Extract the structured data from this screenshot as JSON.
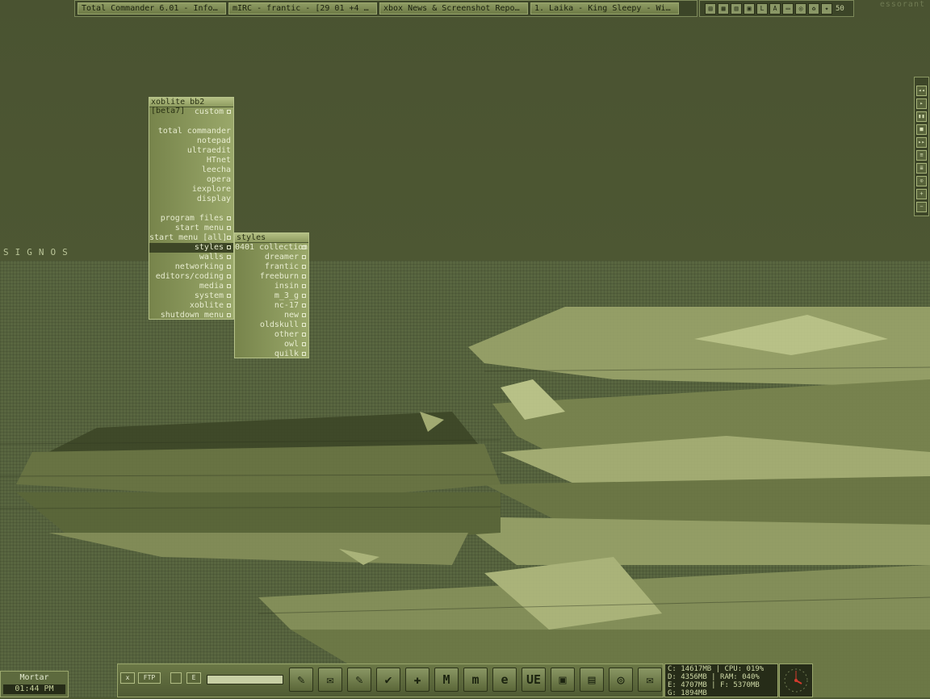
{
  "desktop": {
    "brand_left": "SIGNOS",
    "brand_right": "essorant"
  },
  "taskbar": {
    "tasks": [
      {
        "label": "Total Commander 6.01 - Inform..."
      },
      {
        "label": "mIRC - frantic - [29 01 +4 T24..."
      },
      {
        "label": "xbox News & Screenshot Reposi..."
      },
      {
        "label": "1. Laika - King Sleepy - Winamp"
      }
    ],
    "tray_number": "50"
  },
  "menu": {
    "title": "xoblite bb2 [beta7]",
    "items": [
      {
        "label": "custom",
        "type": "submenu"
      },
      {
        "label": "",
        "type": "separator"
      },
      {
        "label": "total commander",
        "type": "left"
      },
      {
        "label": "notepad",
        "type": "item"
      },
      {
        "label": "ultraedit",
        "type": "item"
      },
      {
        "label": "HTnet",
        "type": "item"
      },
      {
        "label": "leecha",
        "type": "item"
      },
      {
        "label": "opera",
        "type": "item"
      },
      {
        "label": "iexplore",
        "type": "item"
      },
      {
        "label": "display",
        "type": "item"
      },
      {
        "label": "",
        "type": "separator"
      },
      {
        "label": "program files",
        "type": "submenu"
      },
      {
        "label": "start menu",
        "type": "submenu"
      },
      {
        "label": "start menu [all]",
        "type": "submenu"
      },
      {
        "label": "styles",
        "type": "submenu-selected"
      },
      {
        "label": "walls",
        "type": "submenu"
      },
      {
        "label": "networking",
        "type": "submenu"
      },
      {
        "label": "editors/coding",
        "type": "submenu"
      },
      {
        "label": "media",
        "type": "submenu"
      },
      {
        "label": "system",
        "type": "submenu"
      },
      {
        "label": "xoblite",
        "type": "submenu"
      },
      {
        "label": "shutdown menu",
        "type": "submenu"
      }
    ]
  },
  "styles_menu": {
    "title": "styles",
    "items": [
      {
        "label": "0401 collection"
      },
      {
        "label": "dreamer"
      },
      {
        "label": "frantic"
      },
      {
        "label": "freeburn"
      },
      {
        "label": "insin"
      },
      {
        "label": "m_3_g"
      },
      {
        "label": "nc-17"
      },
      {
        "label": "new"
      },
      {
        "label": "oldskull"
      },
      {
        "label": "other"
      },
      {
        "label": "owl"
      },
      {
        "label": "quilk"
      }
    ]
  },
  "player": {
    "buttons": [
      "◂◂",
      "▸",
      "▮▮",
      "■",
      "▸▸",
      "≡",
      "≣",
      "⊙",
      "+",
      "−"
    ]
  },
  "clock": {
    "label": "Mortar",
    "time": "01:44 PM"
  },
  "dock": {
    "buttons": [
      "x",
      "FTP",
      "",
      "E"
    ],
    "launchers": [
      "✎",
      "✉",
      "✎",
      "✔",
      "✚",
      "M",
      "m",
      "e",
      "UE",
      "▣",
      "▤",
      "◎",
      "✉"
    ]
  },
  "stats": {
    "lines": [
      "C: 14617MB | CPU: 019%",
      "D: 4356MB | RAM: 040%",
      "E: 4707MB | F: 5370MB",
      "G: 1894MB"
    ]
  },
  "colors": {
    "background_top": "#4a5331",
    "background_bottom": "#596640",
    "menu_highlight": "#3d4626",
    "accent_light": "#b7c38a"
  }
}
